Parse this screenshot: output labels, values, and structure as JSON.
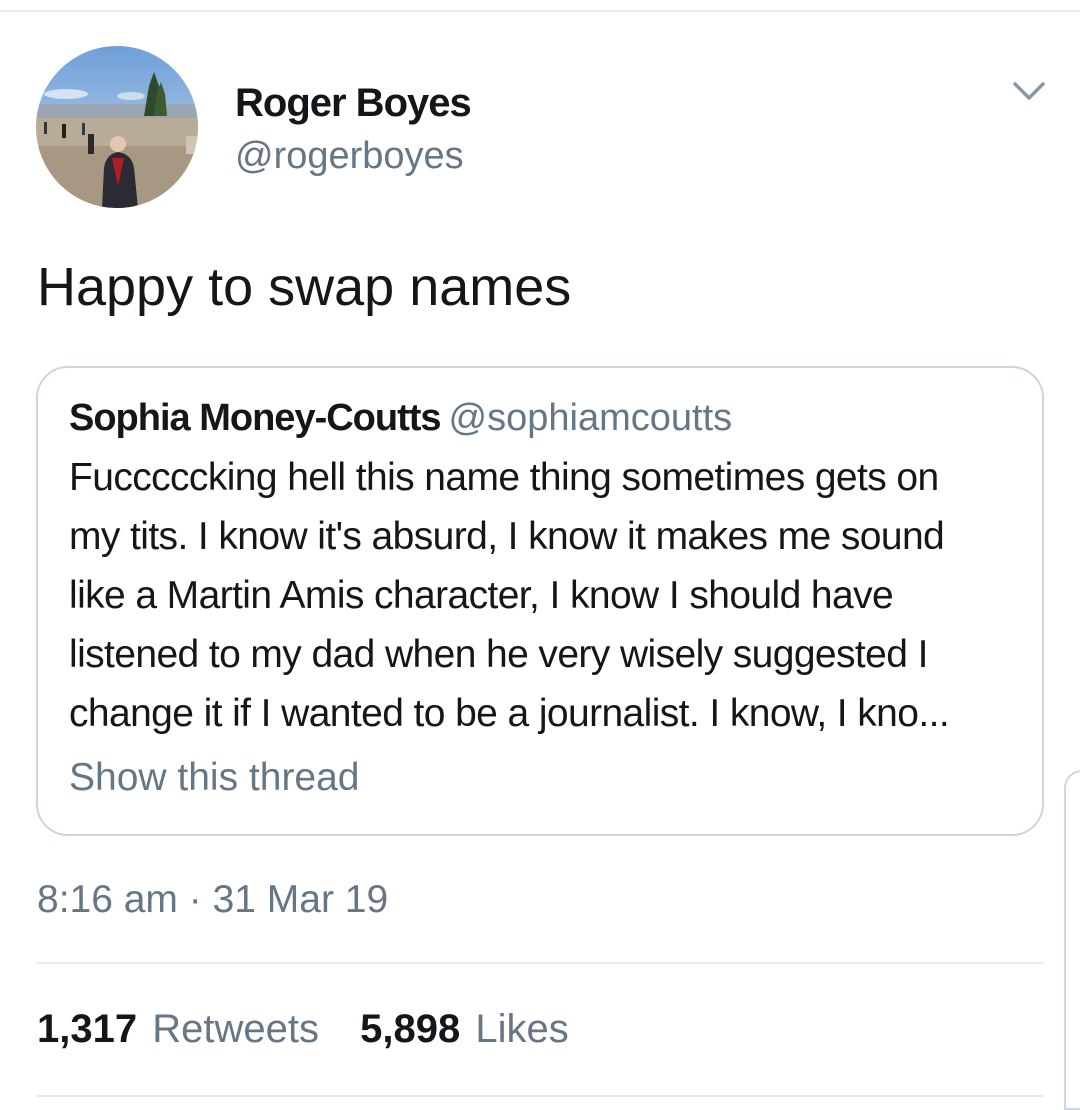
{
  "tweet": {
    "author": {
      "name": "Roger Boyes",
      "handle": "@rogerboyes",
      "avatar_icon": "profile-photo"
    },
    "menu_icon": "chevron-down-icon",
    "text": "Happy to swap names",
    "quoted_tweet": {
      "author_name": "Sophia Money-Coutts",
      "author_handle": "@sophiamcoutts",
      "text_lines": [
        "Fucccccking hell this name thing sometimes gets on",
        "my tits. I know it's absurd, I know it makes me sound",
        "like a Martin Amis character, I know I should have",
        "listened to my dad when he very wisely suggested I",
        "change it if I wanted to be a journalist. I know, I kno..."
      ],
      "show_thread_label": "Show this thread"
    },
    "timestamp": "8:16 am · 31 Mar 19",
    "stats": {
      "retweets_count": "1,317",
      "retweets_label": "Retweets",
      "likes_count": "5,898",
      "likes_label": "Likes"
    }
  },
  "colors": {
    "text_primary": "#14171a",
    "text_secondary": "#657786",
    "border": "#ccd6dd",
    "divider": "#e6ecf0"
  }
}
